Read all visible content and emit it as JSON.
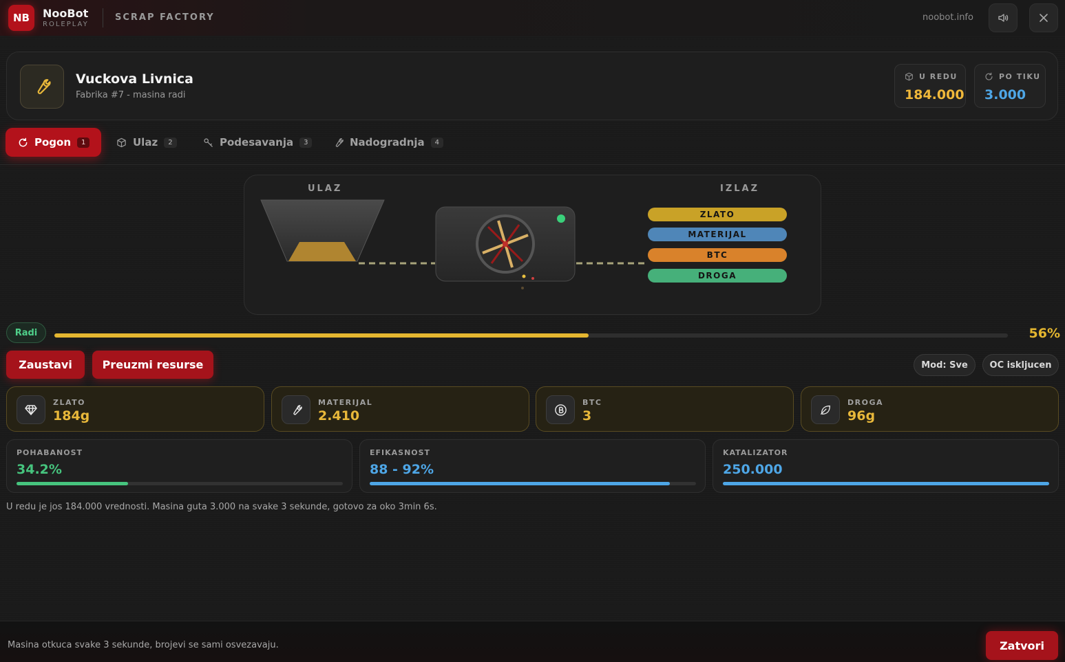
{
  "brand": {
    "badge": "NB",
    "name": "NooBot",
    "sub": "ROLEPLAY",
    "app_title": "SCRAP FACTORY",
    "site": "noobot.info"
  },
  "topbar": {
    "sound_icon": "speaker-icon",
    "close_icon": "close-icon"
  },
  "factory": {
    "icon": "wrench-icon",
    "name": "Vuckova Livnica",
    "subtitle": "Fabrika #7 - masina radi"
  },
  "stats": [
    {
      "label": "U REDU",
      "value": "184.000",
      "icon": "box-icon",
      "color": "#f0b83a"
    },
    {
      "label": "PO TIKU",
      "value": "3.000",
      "icon": "refresh-icon",
      "color": "#4ea6e6"
    }
  ],
  "tabs": [
    {
      "label": "Pogon",
      "num": "1",
      "icon": "refresh-icon",
      "active": true
    },
    {
      "label": "Ulaz",
      "num": "2",
      "icon": "box-icon",
      "active": false
    },
    {
      "label": "Podesavanja",
      "num": "3",
      "icon": "key-icon",
      "active": false
    },
    {
      "label": "Nadogradnja",
      "num": "4",
      "icon": "wrench-icon",
      "active": false
    }
  ],
  "machine": {
    "input_label": "ULAZ",
    "output_label": "IZLAZ",
    "outputs": [
      {
        "label": "ZLATO",
        "color": "#c9a227"
      },
      {
        "label": "MATERIJAL",
        "color": "#4f86b8"
      },
      {
        "label": "BTC",
        "color": "#d9822b"
      },
      {
        "label": "DROGA",
        "color": "#46b07a"
      }
    ]
  },
  "status": {
    "label": "Radi",
    "progress": 56,
    "progress_text": "56%"
  },
  "actions": {
    "stop": "Zaustavi",
    "collect": "Preuzmi resurse",
    "mode": "Mod: Sve",
    "oc": "OC iskljucen"
  },
  "resources": [
    {
      "label": "ZLATO",
      "value": "184g",
      "icon": "diamond-icon"
    },
    {
      "label": "MATERIJAL",
      "value": "2.410",
      "icon": "wrench-icon"
    },
    {
      "label": "BTC",
      "value": "3",
      "icon": "bitcoin-icon"
    },
    {
      "label": "DROGA",
      "value": "96g",
      "icon": "leaf-icon"
    }
  ],
  "metrics": [
    {
      "label": "POHABANOST",
      "value": "34.2%",
      "fill": 0.342,
      "color": "#46c47e"
    },
    {
      "label": "EFIKASNOST",
      "value": "88 - 92%",
      "fill": 0.92,
      "color": "#4ea6e6"
    },
    {
      "label": "KATALIZATOR",
      "value": "250.000",
      "fill": 1.0,
      "color": "#4ea6e6"
    }
  ],
  "info": "U redu je jos 184.000 vrednosti. Masina guta 3.000 na svake 3 sekunde, gotovo za oko 3min 6s.",
  "footer": {
    "text": "Masina otkuca svake 3 sekunde, brojevi se sami osvezavaju.",
    "close": "Zatvori"
  }
}
